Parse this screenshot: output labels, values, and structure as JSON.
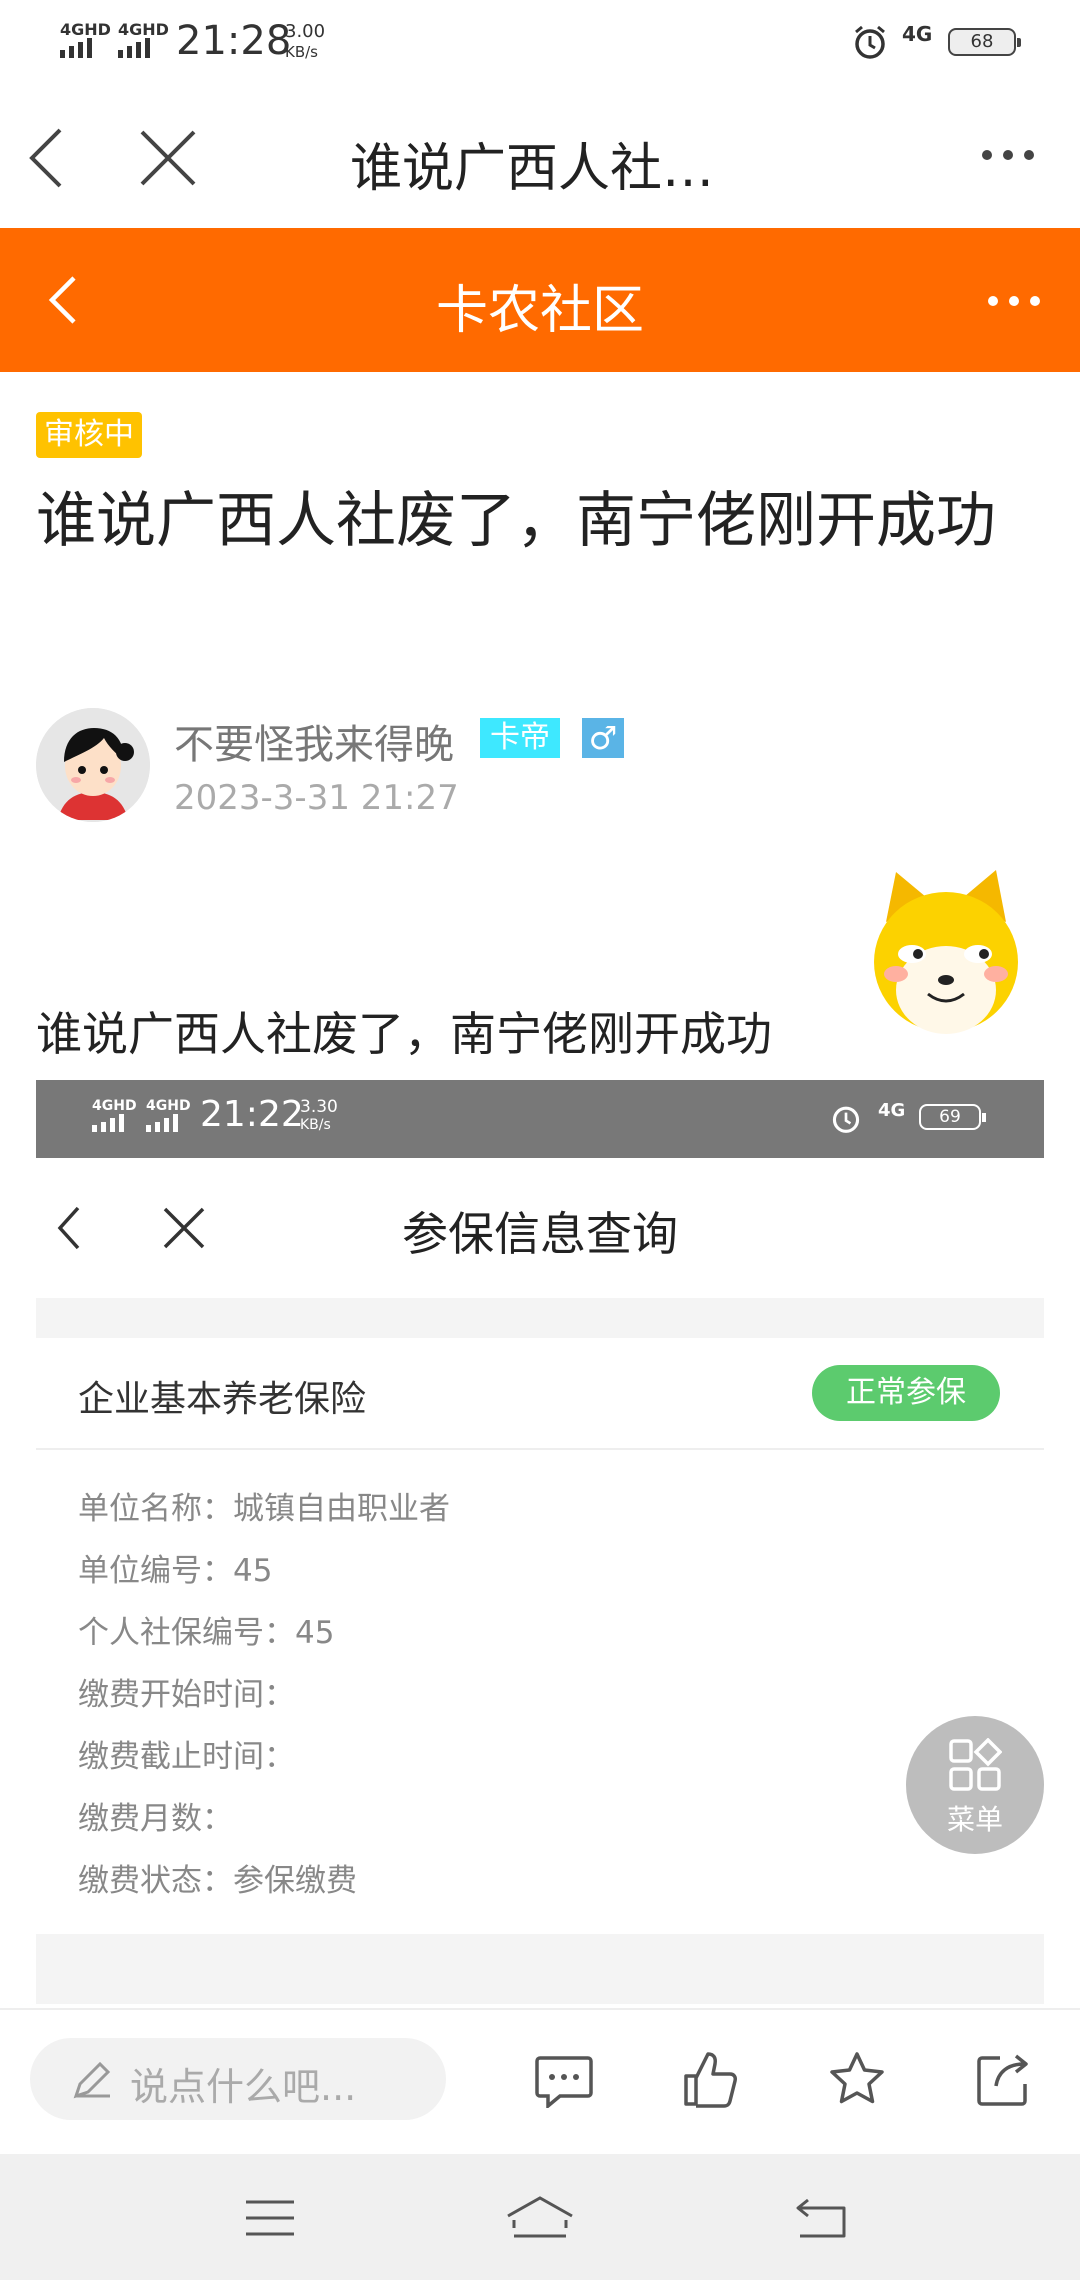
{
  "status_bar": {
    "signal1": "4GHD",
    "signal2": "4GHD",
    "time": "21:28",
    "speed_value": "3.00",
    "speed_unit": "KB/s",
    "network": "4G",
    "battery": "68"
  },
  "browser": {
    "title": "谁说广西人社…",
    "back_icon": "chevron-left-icon",
    "close_icon": "close-icon",
    "more_icon": "more-icon"
  },
  "app_header": {
    "title": "卡农社区",
    "color": "#ff6a00"
  },
  "post": {
    "badge": "审核中",
    "title": "谁说广西人社废了，南宁佬刚开成功",
    "author": "不要怪我来得晚",
    "author_tag": "卡帝",
    "gender": "♂",
    "date": "2023-3-31 21:27",
    "body": "谁说广西人社废了，南宁佬刚开成功"
  },
  "screenshot": {
    "status": {
      "signal1": "4GHD",
      "signal2": "4GHD",
      "time": "21:22",
      "speed_value": "3.30",
      "speed_unit": "KB/s",
      "network": "4G",
      "battery": "69"
    },
    "title": "参保信息查询",
    "card_title": "企业基本养老保险",
    "status_label": "正常参保",
    "status_color": "#5ccb6e",
    "fields": [
      "单位名称：城镇自由职业者",
      "单位编号：45",
      "个人社保编号：45",
      "缴费开始时间：",
      "缴费截止时间：",
      "缴费月数：",
      "缴费状态：参保缴费"
    ]
  },
  "float_menu": {
    "label": "菜单"
  },
  "action_bar": {
    "comment_placeholder": "说点什么吧...",
    "icons": [
      "comment-icon",
      "like-icon",
      "star-icon",
      "share-icon"
    ]
  },
  "nav_bar": {
    "icons": [
      "menu-icon",
      "home-icon",
      "back-icon"
    ]
  }
}
